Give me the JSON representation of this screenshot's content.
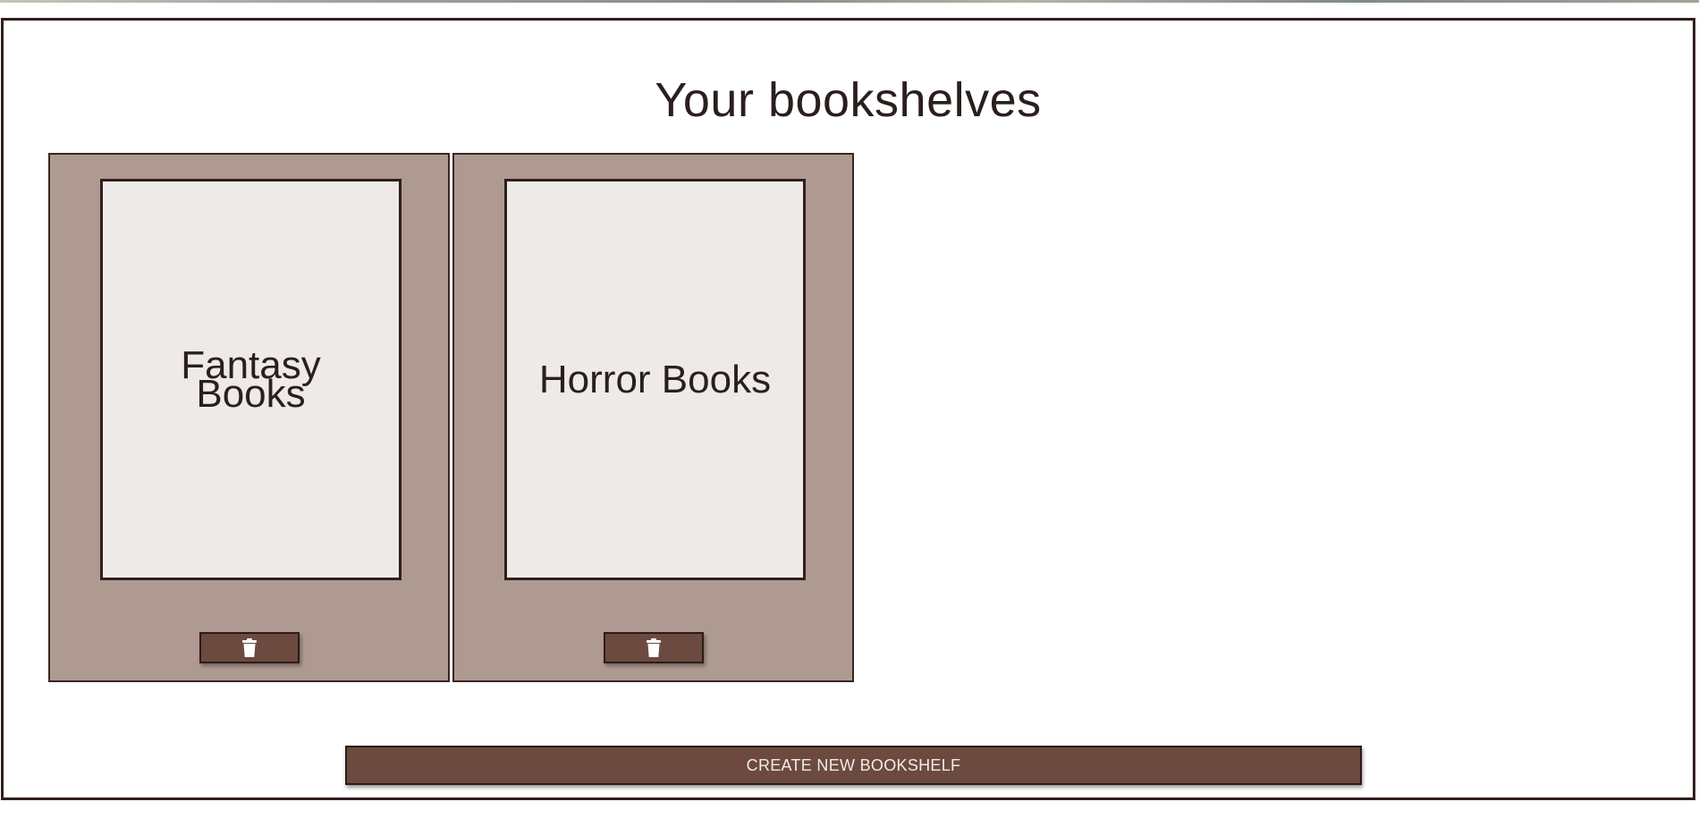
{
  "header": {
    "title": "Your bookshelves"
  },
  "bookshelves": [
    {
      "name": "Fantasy Books",
      "delete_icon": "trash-icon"
    },
    {
      "name": "Horror Books",
      "delete_icon": "trash-icon"
    }
  ],
  "actions": {
    "create_label": "CREATE NEW BOOKSHELF"
  },
  "colors": {
    "border": "#311e1b",
    "card_background": "#af9a91",
    "cover_background": "#eeeae8",
    "button_background": "#6c4a40",
    "button_text": "#f2ebe8"
  }
}
